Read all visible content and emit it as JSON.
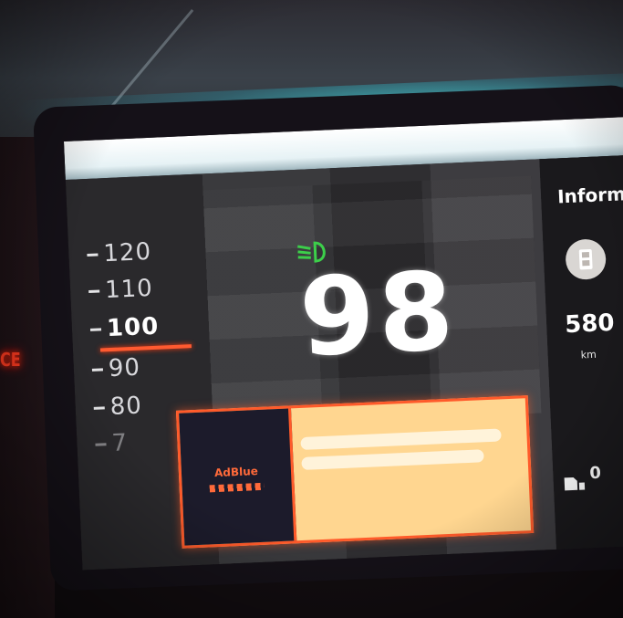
{
  "cluster": {
    "speed_tape": {
      "ticks": [
        "120",
        "110",
        "100",
        "90",
        "80",
        "7"
      ],
      "current": "100"
    },
    "speed": "98",
    "indicators": {
      "headlight": "low-beam-headlight-icon",
      "headlight_color": "#3ccf4a"
    },
    "info_panel": {
      "title": "Inform",
      "range_value": "580",
      "range_unit": "km",
      "bottom_label": "0"
    },
    "alert": {
      "icon_label": "AdBlue"
    },
    "warning_led": {
      "text": "CE",
      "color": "#ff3b20"
    }
  }
}
